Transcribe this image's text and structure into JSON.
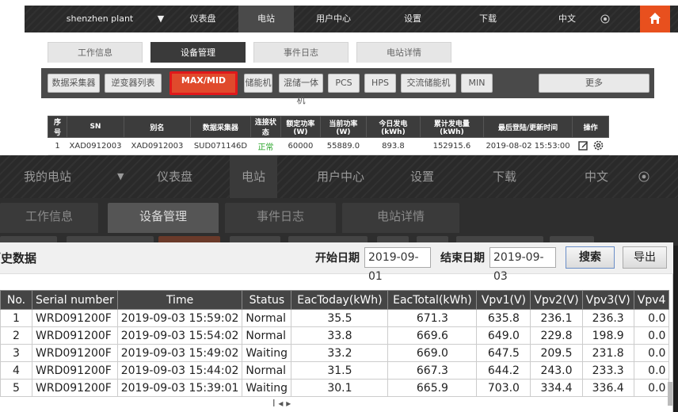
{
  "top_panel": {
    "nav": {
      "plant_select": "shenzhen plant",
      "dropdown_arrow": "▼",
      "items": [
        "仪表盘",
        "电站",
        "用户中心",
        "设置",
        "下载"
      ],
      "language": "中文"
    },
    "tabs": [
      "工作信息",
      "设备管理",
      "事件日志",
      "电站详情"
    ],
    "device_buttons": [
      "数据采集器",
      "逆变器列表",
      "MAX/MID",
      "储能机",
      "混储一体机",
      "PCS",
      "HPS",
      "交流储能机",
      "MIN",
      "更多"
    ],
    "table": {
      "headers": [
        "序号",
        "SN",
        "别名",
        "数据采集器",
        "连接状态",
        "额定功率(W)",
        "当前功率(W)",
        "今日发电(kWh)",
        "累计发电量(kWh)",
        "最后登陆/更新时间",
        "操作"
      ],
      "rows": [
        [
          "1",
          "XAD0912003",
          "XAD0912003",
          "SUD071146D",
          "正常",
          "60000",
          "55889.0",
          "893.8",
          "152915.6",
          "2019-08-02 15:53:00"
        ]
      ]
    }
  },
  "bottom_panel": {
    "nav": {
      "plant_select": "我的电站",
      "dropdown_arrow": "▼",
      "items": [
        "仪表盘",
        "电站",
        "用户中心",
        "设置",
        "下载"
      ],
      "language": "中文"
    },
    "tabs": [
      "工作信息",
      "设备管理",
      "事件日志",
      "电站详情"
    ],
    "history": {
      "title": "历史数据",
      "start_label": "开始日期",
      "start_date": "2019-09-01",
      "end_label": "结束日期",
      "end_date": "2019-09-03",
      "search_button": "搜索",
      "export_button": "导出"
    },
    "table": {
      "headers": [
        "No.",
        "Serial number",
        "Time",
        "Status",
        "EacToday(kWh)",
        "EacTotal(kWh)",
        "Vpv1(V)",
        "Vpv2(V)",
        "Vpv3(V)",
        "Vpv4"
      ],
      "rows": [
        [
          "1",
          "WRD091200F",
          "2019-09-03 15:59:02",
          "Normal",
          "35.5",
          "671.3",
          "635.8",
          "236.1",
          "236.3",
          "0.0"
        ],
        [
          "2",
          "WRD091200F",
          "2019-09-03 15:54:02",
          "Normal",
          "33.8",
          "669.6",
          "649.0",
          "229.8",
          "198.9",
          "0.0"
        ],
        [
          "3",
          "WRD091200F",
          "2019-09-03 15:49:02",
          "Waiting",
          "33.2",
          "669.0",
          "647.5",
          "209.5",
          "231.8",
          "0.0"
        ],
        [
          "4",
          "WRD091200F",
          "2019-09-03 15:44:02",
          "Normal",
          "31.5",
          "667.3",
          "644.2",
          "243.0",
          "233.3",
          "0.0"
        ],
        [
          "5",
          "WRD091200F",
          "2019-09-03 15:39:01",
          "Waiting",
          "30.1",
          "665.9",
          "703.0",
          "334.4",
          "336.4",
          "0.0"
        ]
      ]
    },
    "pager": "Ι ◂ ▸"
  },
  "colors": {
    "accent_orange": "#e8501e",
    "highlight_red": "#e0181b",
    "status_ok_green": "#2aa52a"
  }
}
